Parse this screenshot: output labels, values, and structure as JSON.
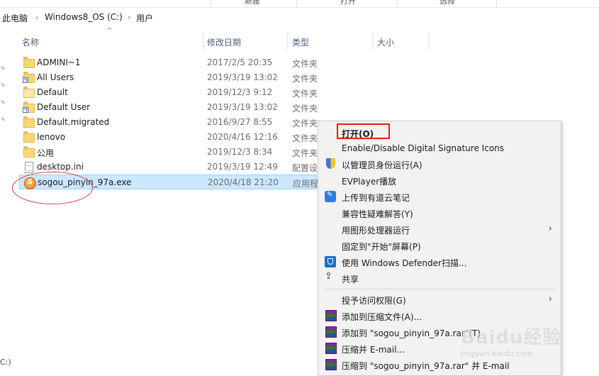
{
  "ribbon": [
    "新建",
    "打开",
    "选择"
  ],
  "breadcrumb": [
    "此电脑",
    "Windows8_OS (C:)",
    "用户"
  ],
  "columns": [
    "名称",
    "修改日期",
    "类型",
    "大小"
  ],
  "files": [
    {
      "name": "ADMINI~1",
      "date": "2017/2/5 20:35",
      "type": "文件夹",
      "icon": "folder-icon"
    },
    {
      "name": "All Users",
      "date": "2019/3/19 13:02",
      "type": "文件夹",
      "icon": "folder-shortcut-icon"
    },
    {
      "name": "Default",
      "date": "2019/12/3 9:12",
      "type": "文件夹",
      "icon": "folder-icon"
    },
    {
      "name": "Default User",
      "date": "2019/3/19 13:02",
      "type": "文件夹",
      "icon": "folder-shortcut-icon"
    },
    {
      "name": "Default.migrated",
      "date": "2016/9/27 8:55",
      "type": "文件夹",
      "icon": "folder-icon"
    },
    {
      "name": "lenovo",
      "date": "2020/4/16 12:16",
      "type": "文件夹",
      "icon": "folder-icon"
    },
    {
      "name": "公用",
      "date": "2019/12/3 8:34",
      "type": "文件夹",
      "icon": "folder-icon"
    },
    {
      "name": "desktop.ini",
      "date": "2019/3/19 12:49",
      "type": "配置设",
      "icon": "config-file-icon"
    },
    {
      "name": "sogou_pinyin_97a.exe",
      "date": "2020/4/18 21:20",
      "type": "应用程",
      "icon": "sogou-app-icon"
    }
  ],
  "context_menu": [
    {
      "label": "打开(O)"
    },
    {
      "label": "Enable/Disable Digital Signature Icons"
    },
    {
      "label": "以管理员身份运行(A)"
    },
    {
      "label": "EVPlayer播放"
    },
    {
      "label": "上传到有道云笔记"
    },
    {
      "label": "兼容性疑难解答(Y)"
    },
    {
      "label": "用图形处理器运行"
    },
    {
      "label": "固定到\"开始\"屏幕(P)"
    },
    {
      "label": "使用 Windows Defender扫描..."
    },
    {
      "label": "共享"
    },
    {
      "label": "授予访问权限(G)"
    },
    {
      "label": "添加到压缩文件(A)..."
    },
    {
      "label": "添加到 \"sogou_pinyin_97a.rar\"(T)"
    },
    {
      "label": "压缩并 E-mail..."
    },
    {
      "label": "压缩到 \"sogou_pinyin_97a.rar\" 并 E-mail"
    }
  ],
  "left_edge_text": "C:)",
  "watermark": {
    "logo": "Baidu经验",
    "url": "jingyan.baidu.com"
  },
  "colors": {
    "selection": "#cce8ff",
    "highlight_box": "#e02020",
    "oval": "#d33a3a",
    "header_text": "#4c607a"
  }
}
